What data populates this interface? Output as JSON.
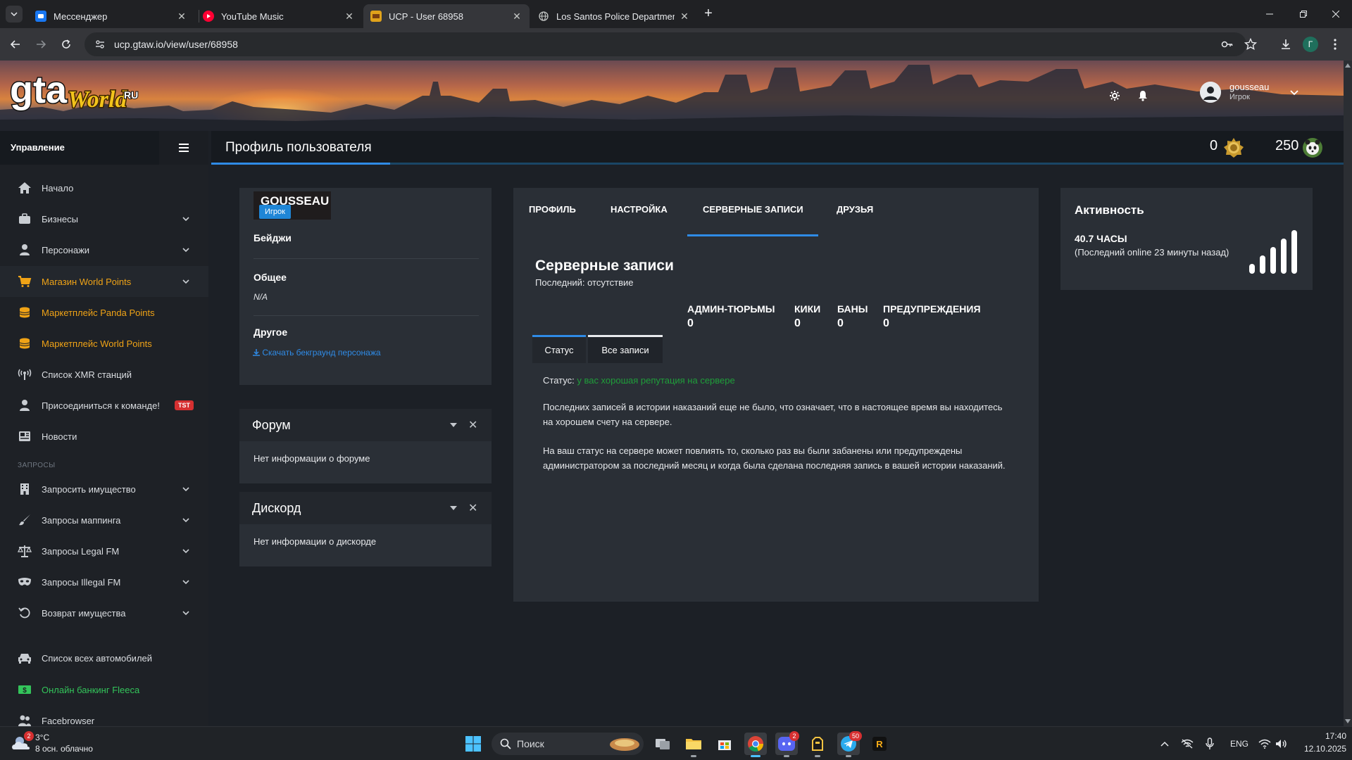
{
  "browser": {
    "tabs": [
      {
        "title": "Мессенджер",
        "favicon": "messenger-icon",
        "active": false
      },
      {
        "title": "YouTube Music",
        "favicon": "youtube-music-icon",
        "active": false
      },
      {
        "title": "UCP - User 68958",
        "favicon": "gtaw-icon",
        "active": true
      },
      {
        "title": "Los Santos Police Department -",
        "favicon": "globe-icon",
        "active": false
      }
    ],
    "url": "ucp.gtaw.io/view/user/68958",
    "profile_initial": "Г"
  },
  "header": {
    "username": "gousseau",
    "role": "Игрок"
  },
  "sidebar": {
    "title": "Управление",
    "items": [
      {
        "label": "Начало",
        "icon": "home-icon",
        "chevron": false,
        "style": "normal"
      },
      {
        "label": "Бизнесы",
        "icon": "business-icon",
        "chevron": true,
        "style": "normal"
      },
      {
        "label": "Персонажи",
        "icon": "person-icon",
        "chevron": true,
        "style": "normal"
      },
      {
        "label": "Магазин World Points",
        "icon": "cart-icon",
        "chevron": true,
        "style": "orange"
      },
      {
        "label": "Маркетплейс Panda Points",
        "icon": "coins-icon",
        "chevron": false,
        "style": "orange"
      },
      {
        "label": "Маркетплейс World Points",
        "icon": "coins-icon",
        "chevron": false,
        "style": "orange"
      },
      {
        "label": "Список XMR станций",
        "icon": "antenna-icon",
        "chevron": false,
        "style": "normal"
      },
      {
        "label": "Присоединиться к команде!",
        "icon": "user-plus-icon",
        "chevron": false,
        "style": "normal",
        "badge": "TST"
      },
      {
        "label": "Новости",
        "icon": "newspaper-icon",
        "chevron": false,
        "style": "normal"
      }
    ],
    "section_requests": "ЗАПРОСЫ",
    "request_items": [
      {
        "label": "Запросить имущество",
        "icon": "building-icon",
        "chevron": true
      },
      {
        "label": "Запросы маппинга",
        "icon": "brush-icon",
        "chevron": true
      },
      {
        "label": "Запросы Legal FM",
        "icon": "scales-icon",
        "chevron": true
      },
      {
        "label": "Запросы Illegal FM",
        "icon": "mask-icon",
        "chevron": true
      },
      {
        "label": "Возврат имущества",
        "icon": "undo-icon",
        "chevron": true
      }
    ],
    "bottom_items": [
      {
        "label": "Список всех автомобилей",
        "icon": "car-icon",
        "style": "normal"
      },
      {
        "label": "Онлайн банкинг Fleeca",
        "icon": "money-icon",
        "style": "green"
      },
      {
        "label": "Facebrowser",
        "icon": "users-icon",
        "style": "normal"
      }
    ]
  },
  "page": {
    "title": "Профиль пользователя",
    "world_points": "0",
    "panda_points": "250"
  },
  "profile_card": {
    "name": "GOUSSEAU",
    "role_badge": "Игрок",
    "badges_title": "Бейджи",
    "general_title": "Общее",
    "general_value": "N/A",
    "other_title": "Другое",
    "download_link": "Скачать бекграунд персонажа"
  },
  "forum_widget": {
    "title": "Форум",
    "body": "Нет информации о форуме"
  },
  "discord_widget": {
    "title": "Дискорд",
    "body": "Нет информации о дискорде"
  },
  "records": {
    "tabs": [
      "ПРОФИЛЬ",
      "НАСТРОЙКА",
      "СЕРВЕРНЫЕ ЗАПИСИ",
      "ДРУЗЬЯ"
    ],
    "active_tab": "СЕРВЕРНЫЕ ЗАПИСИ",
    "heading": "Серверные записи",
    "last": "Последний: отсутствие",
    "stats": [
      {
        "label": "АДМИН-ТЮРЬМЫ",
        "value": "0"
      },
      {
        "label": "КИКИ",
        "value": "0"
      },
      {
        "label": "БАНЫ",
        "value": "0"
      },
      {
        "label": "ПРЕДУПРЕЖДЕНИЯ",
        "value": "0"
      }
    ],
    "subtabs": [
      "Статус",
      "Все записи"
    ],
    "status_label": "Статус:",
    "status_value": "у вас хорошая репутация на сервере",
    "paragraph1": "Последних записей в истории наказаний еще не было, что означает, что в настоящее время вы находитесь на хорошем счету на сервере.",
    "paragraph2": "На ваш статус на сервере может повлиять то, сколько раз вы были забанены или предупреждены администратором за последний месяц и когда была сделана последняя запись в вашей истории наказаний."
  },
  "activity": {
    "title": "Активность",
    "hours": "40.7 ЧАСЫ",
    "last_online": "(Последний online 23 минуты назад)",
    "signal_level": 5
  },
  "taskbar": {
    "weather_temp": "3°C",
    "weather_desc": "8 осн. облачно",
    "weather_badge": "2",
    "search_placeholder": "Поиск",
    "discord_badge": "2",
    "telegram_badge": "50",
    "language": "ENG",
    "time": "17:40",
    "date": "12.10.2025"
  },
  "colors": {
    "accent_blue": "#2f8be6",
    "orange": "#f0a316",
    "green": "#33c45a",
    "status_green": "#1f9e3a",
    "badge_red": "#d63031"
  }
}
